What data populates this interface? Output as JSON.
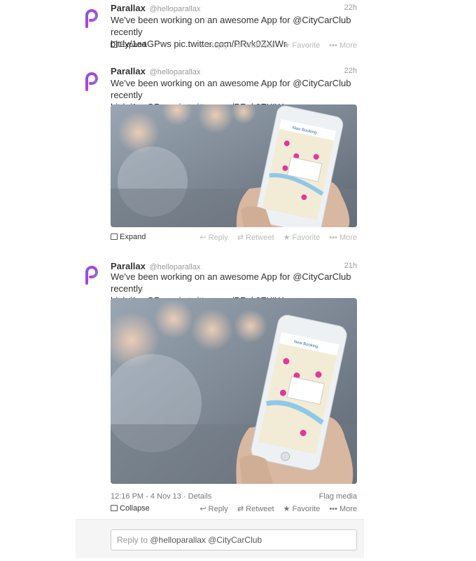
{
  "tweets": [
    {
      "name": "Parallax",
      "handle": "@helloparallax",
      "time": "22h",
      "text_line1": "We've been working on an awesome App for @CityCarClub recently",
      "text_line2": "bit.ly/1eaGPws pic.twitter.com/PRvk0ZXIWr",
      "toggle_label": "Expand",
      "actions": {
        "reply": "Reply",
        "retweet": "Retweet",
        "favorite": "Favorite",
        "more": "More"
      }
    },
    {
      "name": "Parallax",
      "handle": "@helloparallax",
      "time": "22h",
      "text_line1": "We've been working on an awesome App for @CityCarClub recently",
      "text_line2": "bit.ly/1eaGPws pic.twitter.com/PRvk0ZXIWr",
      "toggle_label": "Expand",
      "actions": {
        "reply": "Reply",
        "retweet": "Retweet",
        "favorite": "Favorite",
        "more": "More"
      },
      "phone_screen_title": "New Booking"
    },
    {
      "name": "Parallax",
      "handle": "@helloparallax",
      "time": "21h",
      "text_line1": "We've been working on an awesome App for @CityCarClub recently",
      "text_line2": "bit.ly/1eaGPws pic.twitter.com/PRvk0ZXIWr",
      "timestamp": "12:16 PM - 4 Nov 13",
      "details_label": "Details",
      "flag_label": "Flag media",
      "toggle_label": "Collapse",
      "actions": {
        "reply": "Reply",
        "retweet": "Retweet",
        "favorite": "Favorite",
        "more": "More"
      },
      "phone_screen_title": "New Booking"
    }
  ],
  "reply_box": {
    "placeholder_prefix": "Reply to ",
    "placeholder_mentions": "@helloparallax @CityCarClub"
  },
  "icons": {
    "avatar": "parallax-logo-icon",
    "reply": "reply-arrow-icon",
    "retweet": "retweet-icon",
    "favorite": "star-icon",
    "more": "ellipsis-icon",
    "expand": "expand-card-icon"
  },
  "colors": {
    "logo_gradient_start": "#8a4fd8",
    "logo_gradient_end": "#e03a9e",
    "link": "#333333",
    "muted": "#999999",
    "pin": "#e0389b"
  }
}
